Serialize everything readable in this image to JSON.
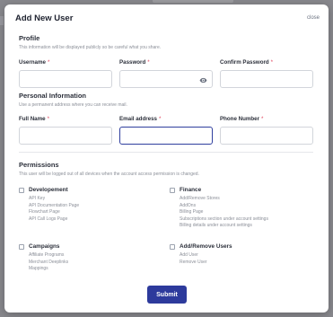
{
  "modal": {
    "title": "Add New User",
    "close_label": "close"
  },
  "profile": {
    "title": "Profile",
    "subtitle": "This information will be displayed publicly so be careful what you share.",
    "fields": [
      {
        "label": "Username",
        "value": ""
      },
      {
        "label": "Password",
        "value": ""
      },
      {
        "label": "Confirm Password",
        "value": ""
      }
    ]
  },
  "personal": {
    "title": "Personal Information",
    "subtitle": "Use a permanent address where you can receive mail.",
    "fields": [
      {
        "label": "Full Name",
        "value": ""
      },
      {
        "label": "Email address",
        "value": ""
      },
      {
        "label": "Phone Number",
        "value": ""
      }
    ]
  },
  "required_marker": "*",
  "permissions": {
    "title": "Permissions",
    "subtitle": "This user will be logged out of all devices when the account access permission is changed.",
    "groups": [
      {
        "name": "Developement",
        "items": [
          "API Key",
          "API Documentation Page",
          "Flowchart Page",
          "API Call Logs Page"
        ]
      },
      {
        "name": "Finance",
        "items": [
          "Add/Remove Stores",
          "AddOns",
          "Billing Page",
          "Subscriptions section under account settings",
          "Billing details under account settings"
        ]
      },
      {
        "name": "Campaigns",
        "items": [
          "Affiliate Programs",
          "Merchant Deeplinks",
          "Mappings"
        ]
      },
      {
        "name": "Add/Remove Users",
        "items": [
          "Add User",
          "Remove User"
        ]
      }
    ]
  },
  "submit_label": "Submit",
  "colors": {
    "primary": "#2d3a9c",
    "required": "#e0455e",
    "focus_border": "#2f3f9e"
  }
}
